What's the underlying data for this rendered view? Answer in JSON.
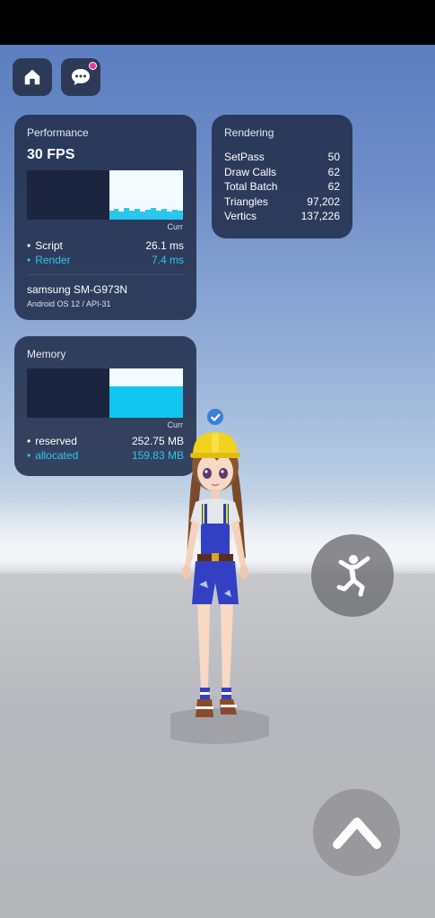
{
  "top_buttons": {
    "home_icon": "home-icon",
    "chat_icon": "chat-bubble-icon",
    "notification_color": "#e8359a"
  },
  "performance": {
    "title": "Performance",
    "fps": "30 FPS",
    "curr_label": "Curr",
    "metrics": [
      {
        "label": "Script",
        "value": "26.1 ms"
      },
      {
        "label": "Render",
        "value": "7.4 ms"
      }
    ],
    "device": "samsung SM-G973N",
    "os": "Android OS 12 / API-31"
  },
  "rendering": {
    "title": "Rendering",
    "rows": [
      {
        "label": "SetPass",
        "value": "50"
      },
      {
        "label": "Draw Calls",
        "value": "62"
      },
      {
        "label": "Total Batch",
        "value": "62"
      },
      {
        "label": "Triangles",
        "value": "97,202"
      },
      {
        "label": "Vertics",
        "value": "137,226"
      }
    ]
  },
  "memory": {
    "title": "Memory",
    "curr_label": "Curr",
    "metrics": [
      {
        "label": "reserved",
        "value": "252.75 MB"
      },
      {
        "label": "allocated",
        "value": "159.83 MB"
      }
    ]
  },
  "colors": {
    "accent_cyan": "#2ec6ef",
    "panel_bg": "#222f4c"
  },
  "controls": {
    "emote_icon": "dance-person-icon",
    "jump_icon": "chevron-up-icon"
  },
  "avatar": {
    "verified_icon": "verified-badge-icon"
  }
}
